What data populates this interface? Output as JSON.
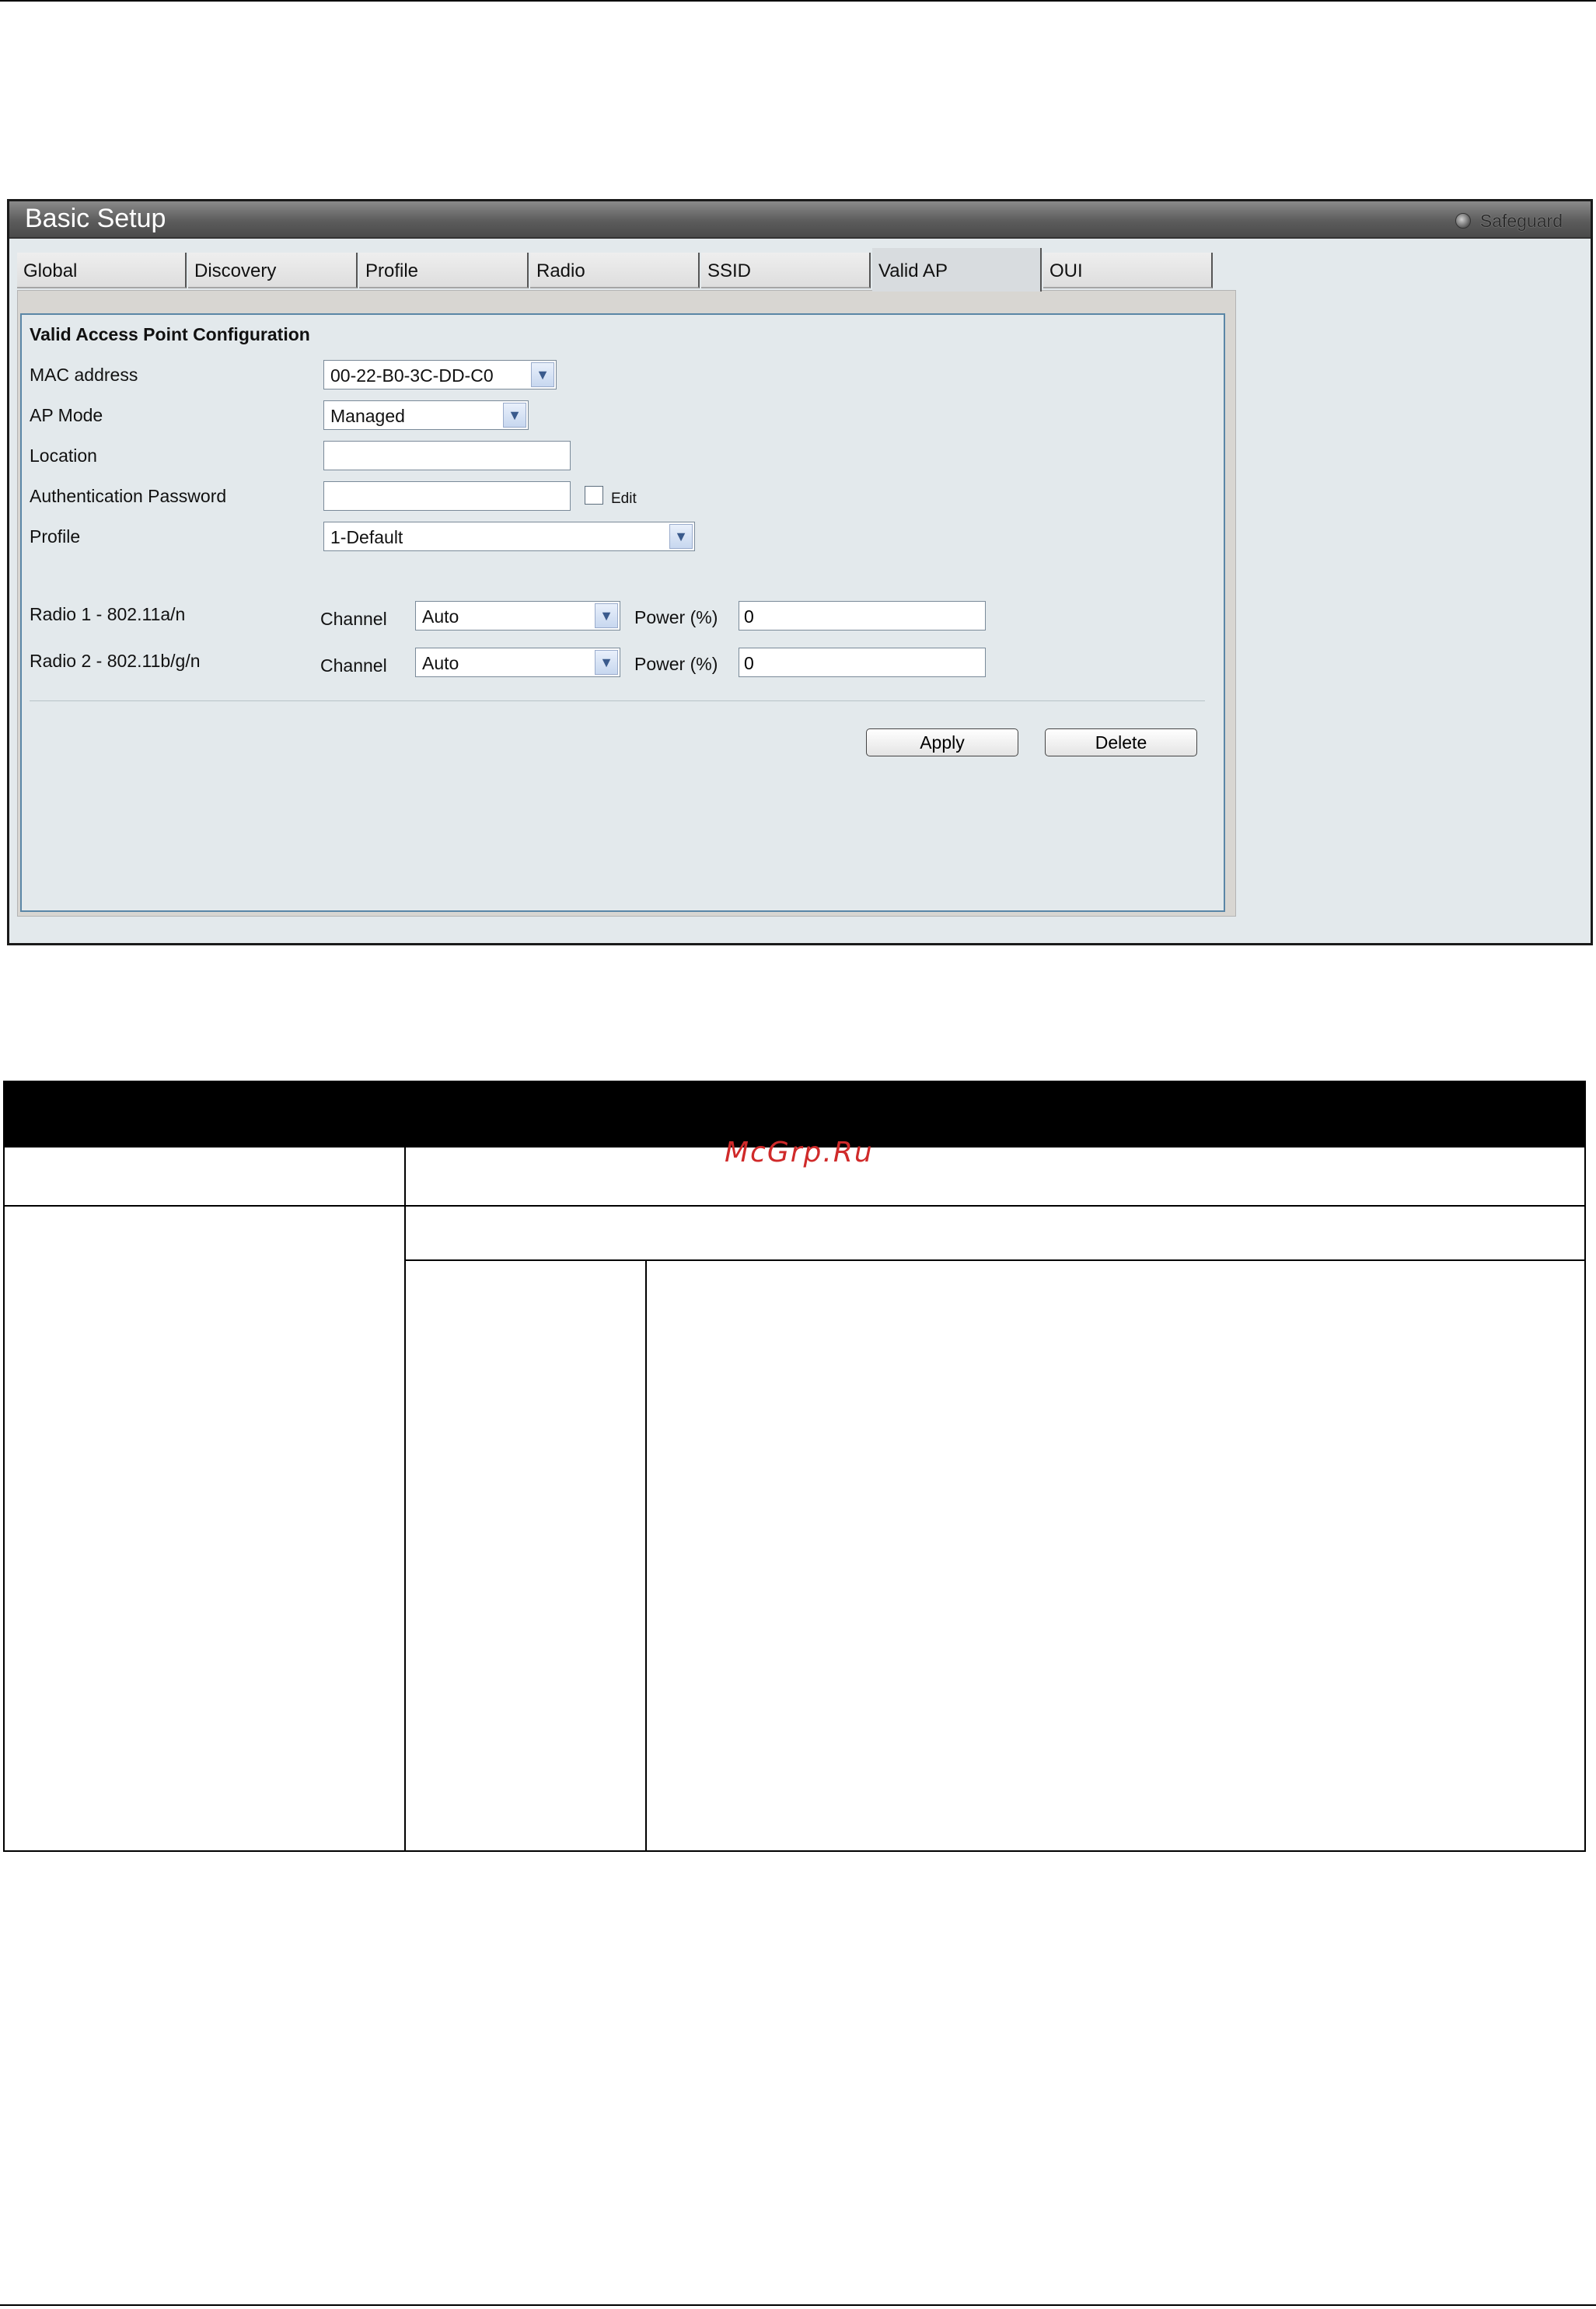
{
  "window": {
    "title": "Basic Setup",
    "safeguard_label": "Safeguard"
  },
  "tabs": [
    {
      "label": "Global",
      "active": false
    },
    {
      "label": "Discovery",
      "active": false
    },
    {
      "label": "Profile",
      "active": false
    },
    {
      "label": "Radio",
      "active": false
    },
    {
      "label": "SSID",
      "active": false
    },
    {
      "label": "Valid AP",
      "active": true
    },
    {
      "label": "OUI",
      "active": false
    }
  ],
  "form": {
    "section_title": "Valid Access Point Configuration",
    "mac_address": {
      "label": "MAC address",
      "value": "00-22-B0-3C-DD-C0"
    },
    "ap_mode": {
      "label": "AP Mode",
      "value": "Managed"
    },
    "location": {
      "label": "Location",
      "value": ""
    },
    "auth_password": {
      "label": "Authentication Password",
      "value": "",
      "edit_label": "Edit"
    },
    "profile": {
      "label": "Profile",
      "value": "1-Default"
    },
    "radio1": {
      "label": "Radio 1 - 802.11a/n",
      "channel_label": "Channel",
      "channel_value": "Auto",
      "power_label": "Power (%)",
      "power_value": "0"
    },
    "radio2": {
      "label": "Radio 2 - 802.11b/g/n",
      "channel_label": "Channel",
      "channel_value": "Auto",
      "power_label": "Power (%)",
      "power_value": "0"
    },
    "apply_label": "Apply",
    "delete_label": "Delete"
  },
  "watermark": "McGrp.Ru"
}
